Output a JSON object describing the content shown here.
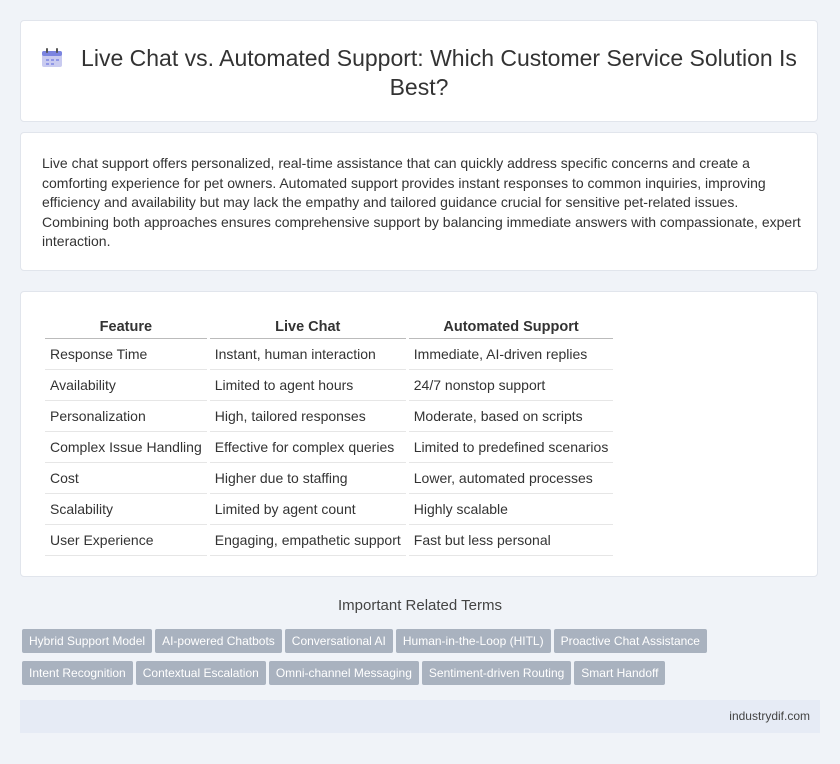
{
  "header": {
    "title": "Live Chat vs. Automated Support: Which Customer Service Solution Is Best?",
    "icon": "calendar-icon"
  },
  "intro": "Live chat support offers personalized, real-time assistance that can quickly address specific concerns and create a comforting experience for pet owners. Automated support provides instant responses to common inquiries, improving efficiency and availability but may lack the empathy and tailored guidance crucial for sensitive pet-related issues. Combining both approaches ensures comprehensive support by balancing immediate answers with compassionate, expert interaction.",
  "table": {
    "headers": [
      "Feature",
      "Live Chat",
      "Automated Support"
    ],
    "rows": [
      [
        "Response Time",
        "Instant, human interaction",
        "Immediate, AI-driven replies"
      ],
      [
        "Availability",
        "Limited to agent hours",
        "24/7 nonstop support"
      ],
      [
        "Personalization",
        "High, tailored responses",
        "Moderate, based on scripts"
      ],
      [
        "Complex Issue Handling",
        "Effective for complex queries",
        "Limited to predefined scenarios"
      ],
      [
        "Cost",
        "Higher due to staffing",
        "Lower, automated processes"
      ],
      [
        "Scalability",
        "Limited by agent count",
        "Highly scalable"
      ],
      [
        "User Experience",
        "Engaging, empathetic support",
        "Fast but less personal"
      ]
    ]
  },
  "related": {
    "title": "Important Related Terms",
    "tags": [
      "Hybrid Support Model",
      "AI-powered Chatbots",
      "Conversational AI",
      "Human-in-the-Loop (HITL)",
      "Proactive Chat Assistance",
      "Intent Recognition",
      "Contextual Escalation",
      "Omni-channel Messaging",
      "Sentiment-driven Routing",
      "Smart Handoff"
    ]
  },
  "footer": {
    "site": "industrydif.com"
  }
}
